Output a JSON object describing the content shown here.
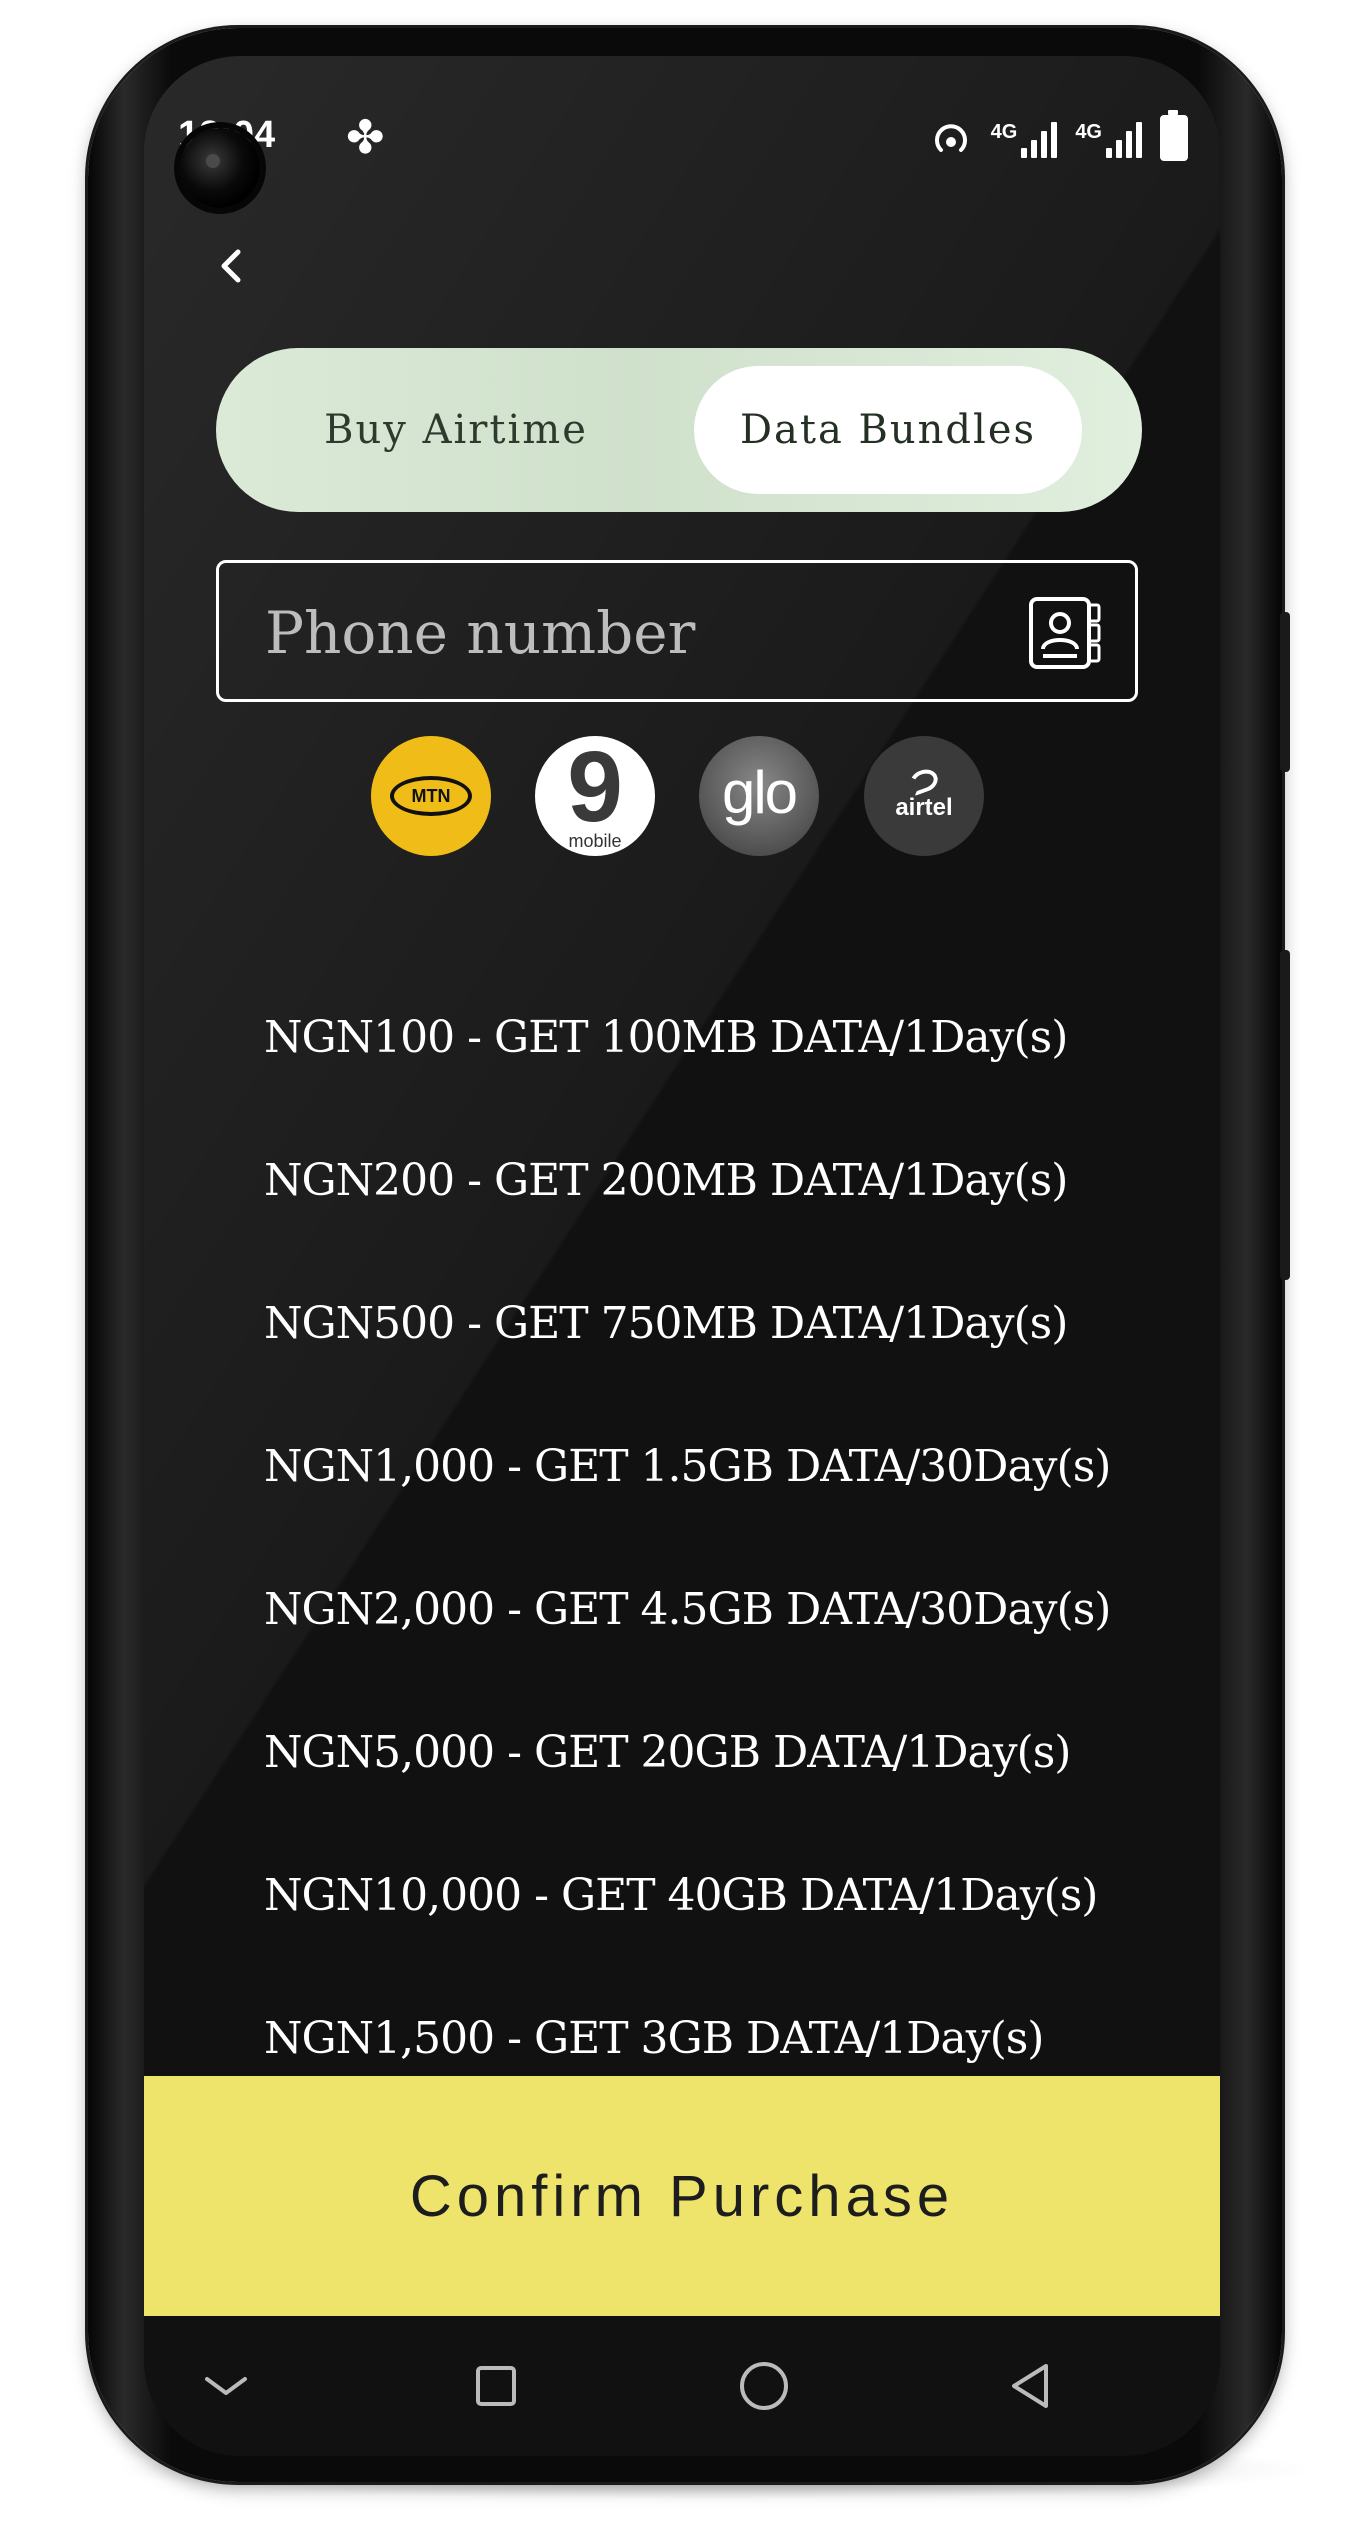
{
  "status_bar": {
    "time": "12:04",
    "network_1": "4G",
    "network_2": "4G"
  },
  "header": {
    "back_icon": "chevron-left-icon"
  },
  "tabs": {
    "buy_airtime": "Buy Airtime",
    "data_bundles": "Data Bundles",
    "selected": "data_bundles"
  },
  "phone_field": {
    "placeholder": "Phone number",
    "value": "",
    "contacts_icon": "contact-book-icon"
  },
  "carriers": [
    {
      "name": "MTN",
      "logo_text": "MTN",
      "color": "#F0BD18"
    },
    {
      "name": "9mobile",
      "logo_text": "9",
      "logo_subtext": "mobile",
      "color": "#FFFFFF"
    },
    {
      "name": "Glo",
      "logo_text": "glo",
      "color": "#6A6A6A"
    },
    {
      "name": "airtel",
      "logo_text": "airtel",
      "color": "#3A3A3A"
    }
  ],
  "bundles": [
    "NGN100 - GET 100MB DATA/1Day(s)",
    "NGN200 - GET 200MB DATA/1Day(s)",
    "NGN500 - GET 750MB DATA/1Day(s)",
    "NGN1,000 - GET 1.5GB DATA/30Day(s)",
    "NGN2,000 - GET 4.5GB DATA/30Day(s)",
    "NGN5,000 - GET 20GB DATA/1Day(s)",
    "NGN10,000 - GET 40GB DATA/1Day(s)",
    "NGN1,500 - GET 3GB DATA/1Day(s)"
  ],
  "confirm_button": {
    "label": "Confirm Purchase",
    "color": "#EEE46C"
  },
  "nav_bar": {
    "icons": [
      "chevron-down-icon",
      "square-icon",
      "circle-icon",
      "triangle-back-icon"
    ]
  },
  "colors": {
    "background": "#111111",
    "toggle_bg": "#DBEAD7",
    "active_tab": "#FFFFFF",
    "text": "#FFFFFF"
  }
}
